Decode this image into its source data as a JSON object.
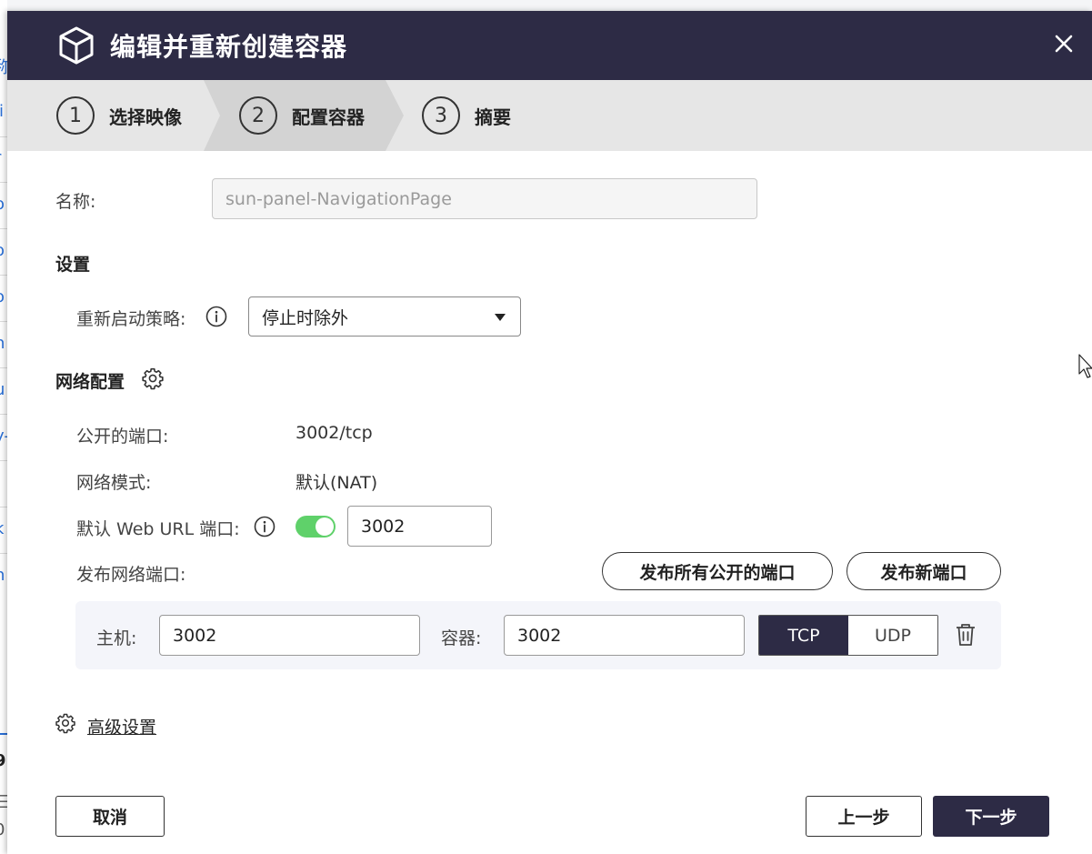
{
  "background_app": {
    "fragments": [
      "称",
      "li",
      "r",
      "o",
      "o",
      "o",
      "n",
      "u",
      "y-",
      "i",
      "k",
      "n",
      "9",
      "三",
      "0"
    ]
  },
  "dialog": {
    "title": "编辑并重新创建容器",
    "icons": {
      "app": "cube-icon",
      "close": "close-icon"
    }
  },
  "steps": [
    {
      "number": "1",
      "label": "选择映像"
    },
    {
      "number": "2",
      "label": "配置容器"
    },
    {
      "number": "3",
      "label": "摘要"
    }
  ],
  "form": {
    "name_label": "名称:",
    "name_value": "sun-panel-NavigationPage",
    "settings_heading": "设置",
    "restart_policy_label": "重新启动策略:",
    "restart_policy_value": "停止时除外",
    "network_heading": "网络配置",
    "exposed_ports_label": "公开的端口:",
    "exposed_ports_value": "3002/tcp",
    "network_mode_label": "网络模式:",
    "network_mode_value": "默认(NAT)",
    "web_url_port_label": "默认 Web URL 端口:",
    "web_url_port_enabled": true,
    "web_url_port_value": "3002",
    "publish_ports_label": "发布网络端口:",
    "publish_all_button": "发布所有公开的端口",
    "publish_new_button": "发布新端口",
    "port_mapping": {
      "host_label": "主机:",
      "host_value": "3002",
      "container_label": "容器:",
      "container_value": "3002",
      "protocols": [
        "TCP",
        "UDP"
      ],
      "selected_protocol": "TCP"
    },
    "advanced_settings_label": "高级设置"
  },
  "footer": {
    "cancel_label": "取消",
    "prev_label": "上一步",
    "next_label": "下一步"
  },
  "colors": {
    "header_bg": "#2d2b45",
    "toggle_on": "#5fd16a",
    "primary_button": "#2d2b45"
  }
}
